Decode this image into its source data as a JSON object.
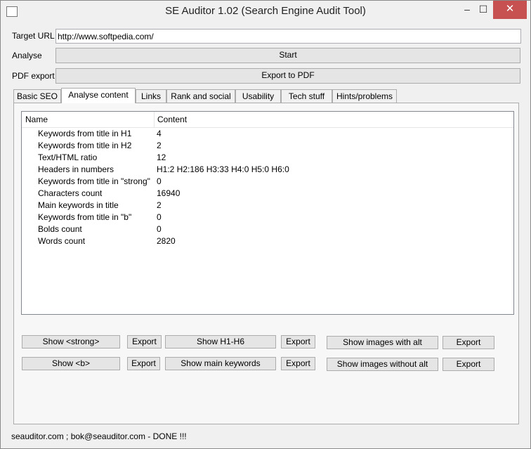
{
  "window": {
    "title": "SE Auditor 1.02 (Search Engine Audit Tool)",
    "minimize": "–",
    "maximize": "☐",
    "close": "✕"
  },
  "form": {
    "target_url_label": "Target URL",
    "target_url_value": "http://www.softpedia.com/",
    "analyse_label": "Analyse",
    "start_button": "Start",
    "pdf_label": "PDF export",
    "pdf_button": "Export to PDF"
  },
  "tabs": [
    {
      "label": "Basic SEO",
      "active": false
    },
    {
      "label": "Analyse content",
      "active": true
    },
    {
      "label": "Links",
      "active": false
    },
    {
      "label": "Rank and social",
      "active": false
    },
    {
      "label": "Usability",
      "active": false
    },
    {
      "label": "Tech stuff",
      "active": false
    },
    {
      "label": "Hints/problems",
      "active": false
    }
  ],
  "table": {
    "columns": [
      "Name",
      "Content"
    ],
    "rows": [
      {
        "name": "Keywords from title in H1",
        "value": "4"
      },
      {
        "name": "Keywords from title in H2",
        "value": "2"
      },
      {
        "name": "Text/HTML ratio",
        "value": "12"
      },
      {
        "name": "Headers in numbers",
        "value": "H1:2 H2:186 H3:33 H4:0 H5:0 H6:0"
      },
      {
        "name": "Keywords from title in \"strong\"",
        "value": "0"
      },
      {
        "name": "Characters count",
        "value": "16940"
      },
      {
        "name": "Main keywords in title",
        "value": "2"
      },
      {
        "name": "Keywords from title in \"b\"",
        "value": "0"
      },
      {
        "name": "Bolds count",
        "value": "0"
      },
      {
        "name": "Words count",
        "value": "2820"
      }
    ]
  },
  "buttons": {
    "show_strong": "Show <strong>",
    "show_b": "Show <b>",
    "show_h1_h6": "Show H1-H6",
    "show_main_keywords": "Show main keywords",
    "show_images_with_alt": "Show images with alt",
    "show_images_without_alt": "Show images without alt",
    "export": "Export"
  },
  "status_text": "seauditor.com ; bok@seauditor.com - DONE !!!"
}
